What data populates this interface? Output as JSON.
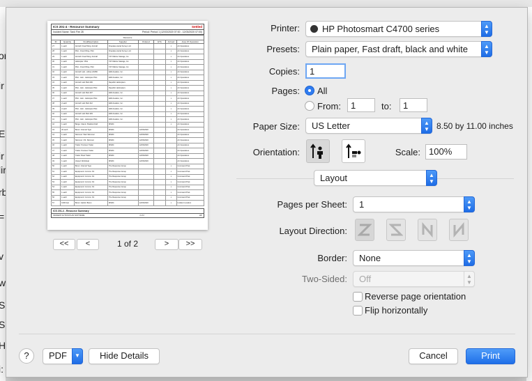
{
  "background_fragments": [
    "or",
    "ir",
    "E",
    "ir",
    "lir",
    "rb",
    "=",
    "v",
    "w",
    "S",
    "S",
    "H",
    "i:"
  ],
  "preview": {
    "form_title": "ICS 201-4 - Resource Summary",
    "form_flag": "Settled",
    "incident_name": "Incident Name: Tank Fire 28",
    "period": "Period: Period 1 (12/03/2020 07:00 - 12/03/2020 07:00)",
    "group_header": "Resource",
    "columns": [
      "ID",
      "Quantity",
      "Kind/Description",
      "Supplier",
      "Ordered",
      "ETA",
      "Arrived",
      "Area Of Operation"
    ],
    "rows": [
      [
        "27",
        "1 each",
        "Aircraft: Fixed Wing: Aircraft",
        "Fireplace Aerial Survey LLC",
        "",
        "",
        "x",
        "Air Operations"
      ],
      [
        "28",
        "1 each",
        "Pilot - Fixed Wing, Pilot",
        "Fireplace Aerial Survey LLC",
        "",
        "",
        "x",
        "Air Operations"
      ],
      [
        "29",
        "1 each",
        "Aircraft: Fixed Wing: Aircraft",
        "T&T Marine Salvage, Inc.",
        "",
        "",
        "x",
        "Air Operations"
      ],
      [
        "30",
        "1 each",
        "Helicopter: Pilot",
        "T&T Marine Salvage, Inc.",
        "",
        "",
        "x",
        "Air Operations"
      ],
      [
        "31",
        "1 each",
        "Pilot - Fixed Wing, Pilot",
        "T&T Marine Salvage, Inc.",
        "",
        "",
        "x",
        "Air Operations"
      ],
      [
        "32",
        "1 each",
        "Aircraft: Heli - Airbus AS350",
        "ERA Aviation, Inc.",
        "",
        "",
        "x",
        "Air Operations"
      ],
      [
        "33",
        "1 each",
        "Pilot - Heli - Helicopter Pilot",
        "ERA Aviation, Inc.",
        "",
        "",
        "x",
        "Air Operations"
      ],
      [
        "34",
        "1 each",
        "Aircraft: Heli: Bell 206",
        "Republic Helicopters",
        "",
        "",
        "x",
        "Air Operations"
      ],
      [
        "35",
        "1 each",
        "Pilot - Heli - Helicopter Pilot",
        "Republic Helicopters",
        "",
        "",
        "x",
        "Air Operations"
      ],
      [
        "36",
        "1 each",
        "Aircraft: Heli: Bell 407",
        "ERA Aviation, Inc.",
        "",
        "",
        "x",
        "Air Operations"
      ],
      [
        "37",
        "1 each",
        "Pilot - Heli - Helicopter Pilot",
        "ERA Aviation, Inc.",
        "",
        "",
        "x",
        "Air Operations"
      ],
      [
        "38",
        "2 each",
        "Aircraft: Heli: Bell 412",
        "ERA Aviation, Inc.",
        "",
        "",
        "x",
        "Air Operations"
      ],
      [
        "39",
        "2 each",
        "Pilot - Heli - Helicopter Pilot",
        "ERA Aviation, Inc.",
        "",
        "",
        "x",
        "Air Operations"
      ],
      [
        "40",
        "1 each",
        "Aircraft: Heli: Bell 429",
        "ERA Aviation, Inc.",
        "",
        "",
        "x",
        "Air Operations"
      ],
      [
        "41",
        "1 each",
        "Pilot - Heli - Helicopter Pilot",
        "ERA Aviation, Inc.",
        "",
        "",
        "x",
        "Air Operations"
      ],
      [
        "42",
        "1 each",
        "Barge: Inland, Shallow Draft",
        "MSRC",
        "",
        "",
        "x",
        "Air Operations"
      ],
      [
        "43",
        "20 each",
        "Boom: Internal Type",
        "MSRC",
        "12/03/2020",
        "",
        "",
        "Air Operations"
      ],
      [
        "44",
        "1 each",
        "Skimmer: Weir Skimmer",
        "MSRC",
        "12/03/2020",
        "",
        "",
        "Air Operations"
      ],
      [
        "45",
        "1 each",
        "Skimmer: OS: Skimmer",
        "MSRC",
        "12/03/2020",
        "",
        "",
        "Air Operations"
      ],
      [
        "46",
        "1 each",
        "Trailer: Pontoon Trailer",
        "MSRC",
        "12/03/2020",
        "",
        "",
        "Air Operations"
      ],
      [
        "47",
        "1 each",
        "Trailer: Pontoon Trailer",
        "MSRC",
        "12/03/2020",
        "",
        "",
        "Air Operations"
      ],
      [
        "48",
        "1 each",
        "Trailer: Boat Trailer",
        "MSRC",
        "12/03/2020",
        "",
        "",
        "Air Operations"
      ],
      [
        "49",
        "1 each",
        "Vessel: Workboat",
        "MSRC",
        "12/03/2020",
        "",
        "",
        "Air Operations"
      ],
      [
        "50",
        "1 each",
        "Boom: Internal Type",
        "The Response Group",
        "",
        "",
        "x",
        "Command Post"
      ],
      [
        "51",
        "1 each",
        "Equipment: Comms: Kit",
        "The Response Group",
        "",
        "",
        "x",
        "Command Post"
      ],
      [
        "52",
        "1 each",
        "Equipment: Comms: Kit",
        "The Response Group",
        "",
        "",
        "x",
        "Command Post"
      ],
      [
        "53",
        "1 each",
        "Equipment: Comms: Kit",
        "The Response Group",
        "",
        "",
        "x",
        "Command Post"
      ],
      [
        "54",
        "1 each",
        "Equipment: Comms: Kit",
        "The Response Group",
        "",
        "",
        "x",
        "Command Post"
      ],
      [
        "55",
        "1 each",
        "Equipment: Comms: Kit",
        "The Response Group",
        "",
        "",
        "x",
        "Command Post"
      ],
      [
        "56",
        "1 each",
        "Equipment: Comms: Kit",
        "The Response Group",
        "",
        "",
        "x",
        "Command Post"
      ],
      [
        "57",
        "1000 feet",
        "Boom: Harbor Boom",
        "MSRC",
        "12/03/2020",
        "",
        "x",
        "Incident Location"
      ]
    ],
    "footer_title": "ICS 201-4 - Resource Summary",
    "footer_note": "INCIDENT ACTION PLAN SOFTWARE",
    "footer_page": "2 of 2",
    "footer_brand": "IAP"
  },
  "pager": {
    "first_label": "<<",
    "prev_label": "<",
    "page_indicator": "1 of 2",
    "next_label": ">",
    "last_label": ">>"
  },
  "printer": {
    "label": "Printer:",
    "value": "HP Photosmart C4700 series"
  },
  "presets": {
    "label": "Presets:",
    "value": "Plain paper, Fast draft, black and white"
  },
  "copies": {
    "label": "Copies:",
    "value": "1"
  },
  "pages": {
    "label": "Pages:",
    "all_label": "All",
    "from_label": "From:",
    "from_value": "1",
    "to_label": "to:",
    "to_value": "1",
    "selected": "All"
  },
  "paper_size": {
    "label": "Paper Size:",
    "value": "US Letter",
    "dimensions": "8.50 by 11.00 inches"
  },
  "orientation": {
    "label": "Orientation:",
    "selected": "portrait"
  },
  "scale": {
    "label": "Scale:",
    "value": "100%"
  },
  "section": {
    "value": "Layout"
  },
  "pages_per_sheet": {
    "label": "Pages per Sheet:",
    "value": "1"
  },
  "layout_direction": {
    "label": "Layout Direction:"
  },
  "border": {
    "label": "Border:",
    "value": "None"
  },
  "two_sided": {
    "label": "Two-Sided:",
    "value": "Off"
  },
  "reverse_orientation": {
    "label": "Reverse page orientation",
    "checked": false
  },
  "flip_horizontally": {
    "label": "Flip horizontally",
    "checked": false
  },
  "footer": {
    "help_label": "?",
    "pdf_label": "PDF",
    "hide_details_label": "Hide Details",
    "cancel_label": "Cancel",
    "print_label": "Print"
  },
  "colors": {
    "accent": "#2f7cf0",
    "primary_button": "#1f6fe8",
    "dialog_bg": "#ececec"
  }
}
